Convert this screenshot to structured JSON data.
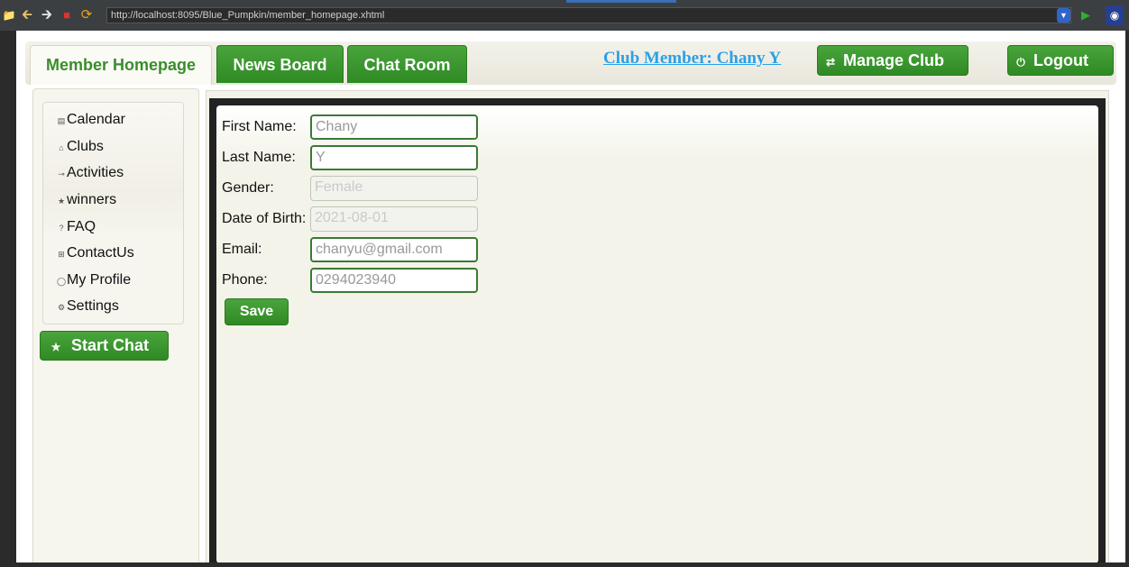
{
  "browser": {
    "url": "http://localhost:8095/Blue_Pumpkin/member_homepage.xhtml"
  },
  "tabs": [
    {
      "label": "Member Homepage",
      "active": true
    },
    {
      "label": "News Board",
      "active": false
    },
    {
      "label": "Chat Room",
      "active": false
    }
  ],
  "header": {
    "member_link": "Club Member: Chany Y",
    "manage_club": "Manage Club",
    "logout": "Logout"
  },
  "sidebar": {
    "items": [
      {
        "label": "Calendar",
        "icon": "calendar-icon"
      },
      {
        "label": "Clubs",
        "icon": "home-icon"
      },
      {
        "label": "Activities",
        "icon": "pin-icon"
      },
      {
        "label": "winners",
        "icon": "star-icon"
      },
      {
        "label": "FAQ",
        "icon": "help-icon"
      },
      {
        "label": "ContactUs",
        "icon": "contact-icon"
      },
      {
        "label": "My Profile",
        "icon": "person-icon"
      },
      {
        "label": "Settings",
        "icon": "gear-icon"
      }
    ],
    "start_chat": "Start Chat"
  },
  "form": {
    "fields": [
      {
        "label": "First Name:",
        "value": "Chany",
        "disabled": false
      },
      {
        "label": "Last Name:",
        "value": "Y",
        "disabled": false
      },
      {
        "label": "Gender:",
        "value": "Female",
        "disabled": true
      },
      {
        "label": "Date of Birth:",
        "value": "2021-08-01",
        "disabled": true
      },
      {
        "label": "Email:",
        "value": "chanyu@gmail.com",
        "disabled": false
      },
      {
        "label": "Phone:",
        "value": "0294023940",
        "disabled": false
      }
    ],
    "save_label": "Save"
  },
  "colors": {
    "accent_green": "#3a8d2b",
    "link_blue": "#2aa0e8"
  }
}
